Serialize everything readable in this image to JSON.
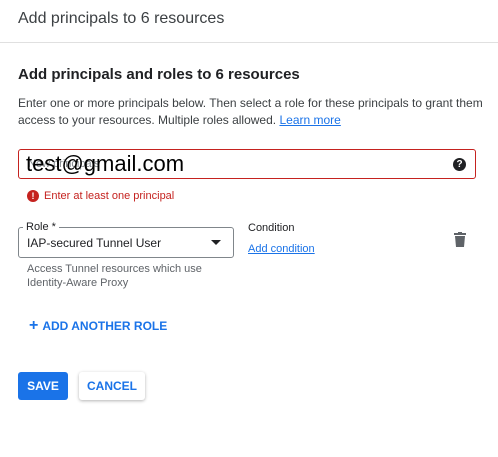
{
  "dialog": {
    "title": "Add principals to 6 resources"
  },
  "section": {
    "title": "Add principals and roles to 6 resources",
    "description": "Enter one or more principals below. Then select a role for these principals to grant them access to your resources. Multiple roles allowed.",
    "learn_more": "Learn more"
  },
  "principals": {
    "label": "New principals",
    "value": "test@gmail.com",
    "help_icon": "help-circle-icon",
    "error": "Enter at least one principal",
    "error_icon": "error-icon"
  },
  "role": {
    "label": "Role *",
    "selected": "IAP-secured Tunnel User",
    "hint": "Access Tunnel resources which use Identity-Aware Proxy"
  },
  "condition": {
    "label": "Condition",
    "add_link": "Add condition"
  },
  "delete_icon": "trash-icon",
  "add_role": {
    "icon": "plus-icon",
    "label": "ADD ANOTHER ROLE"
  },
  "buttons": {
    "save": "SAVE",
    "cancel": "CANCEL"
  },
  "colors": {
    "accent": "#1a73e8",
    "error": "#c5221f"
  }
}
